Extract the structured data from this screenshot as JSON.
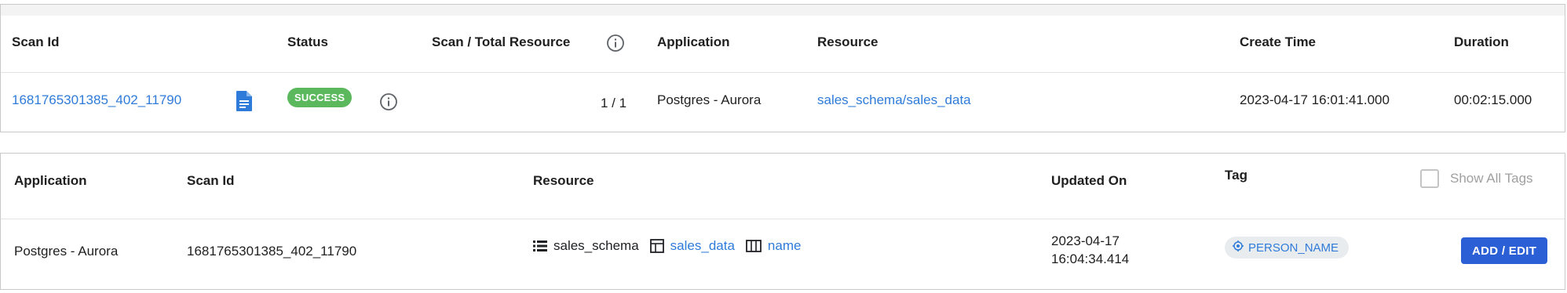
{
  "scan_table": {
    "headers": {
      "scan_id": "Scan Id",
      "status": "Status",
      "scan_total": "Scan / Total Resource",
      "application": "Application",
      "resource": "Resource",
      "create_time": "Create Time",
      "duration": "Duration"
    },
    "row": {
      "scan_id": "1681765301385_402_11790",
      "status": "SUCCESS",
      "scan_total": "1 / 1",
      "application": "Postgres - Aurora",
      "resource": "sales_schema/sales_data",
      "create_time": "2023-04-17 16:01:41.000",
      "duration": "00:02:15.000"
    }
  },
  "tag_table": {
    "headers": {
      "application": "Application",
      "scan_id": "Scan Id",
      "resource": "Resource",
      "updated_on": "Updated On",
      "tag": "Tag",
      "show_all_tags": "Show All Tags"
    },
    "row": {
      "application": "Postgres - Aurora",
      "scan_id": "1681765301385_402_11790",
      "schema": "sales_schema",
      "table": "sales_data",
      "column": "name",
      "updated_date": "2023-04-17",
      "updated_time": "16:04:34.414",
      "tag": "PERSON_NAME",
      "action": "ADD / EDIT"
    }
  },
  "icons": {
    "report": "document-icon",
    "info": "info-icon",
    "schema": "database-list-icon",
    "table": "table-icon",
    "column": "column-icon",
    "tag": "tag-target-icon"
  },
  "colors": {
    "link": "#2f7bd9",
    "success": "#5cb85c",
    "primary_button": "#2a5fd6",
    "chip_bg": "#e9ecef"
  }
}
